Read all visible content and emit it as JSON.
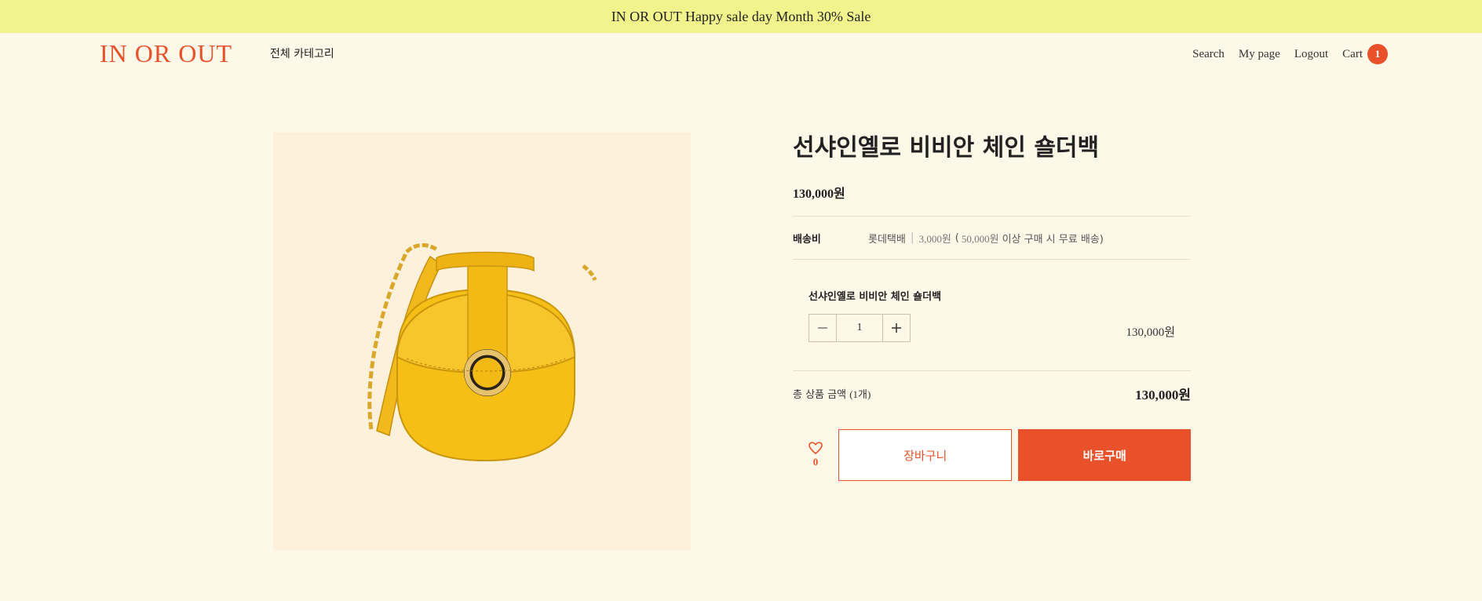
{
  "banner": {
    "text": "IN OR OUT Happy sale day Month 30% Sale"
  },
  "header": {
    "logo": "IN OR OUT",
    "category_label": "전체 카테고리",
    "nav": {
      "search": "Search",
      "mypage": "My page",
      "logout": "Logout",
      "cart": "Cart",
      "cart_count": "1"
    }
  },
  "product": {
    "title": "선샤인옐로 비비안 체인 숄더백",
    "price": "130,000원",
    "shipping": {
      "label": "배송비",
      "carrier": "롯데택배",
      "fee": "3,000원",
      "condition_prefix": "(",
      "threshold": "50,000원",
      "condition_suffix": "이상 구매 시 무료 배송)"
    },
    "option": {
      "name": "선샤인옐로 비비안 체인 숄더백",
      "quantity": "1",
      "price": "130,000원"
    },
    "total": {
      "label": "총 상품 금액",
      "count": "(1개)",
      "value": "130,000원"
    },
    "wishlist_count": "0",
    "buttons": {
      "cart": "장바구니",
      "buy": "바로구매"
    }
  },
  "colors": {
    "accent": "#e8512a",
    "banner": "#f1f48c",
    "background": "#fef8e8",
    "image_bg": "#fdf1dc"
  },
  "icons": {
    "minus": "minus-icon",
    "plus": "plus-icon",
    "heart": "heart-icon"
  }
}
